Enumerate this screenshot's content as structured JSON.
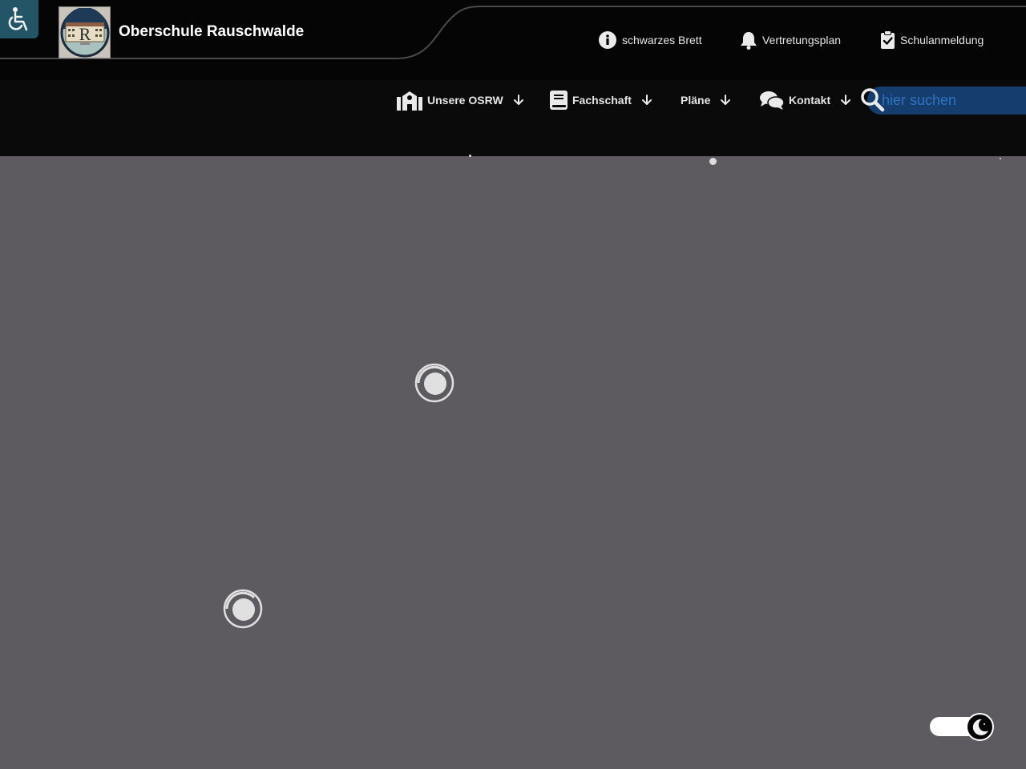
{
  "site": {
    "title": "Oberschule Rauschwalde",
    "logo_letter": "R"
  },
  "top_links": [
    {
      "label": "schwarzes Brett",
      "icon": "info-circle-icon"
    },
    {
      "label": "Vertretungsplan",
      "icon": "bell-icon"
    },
    {
      "label": "Schulanmeldung",
      "icon": "clipboard-check-icon"
    }
  ],
  "nav": [
    {
      "label": "Unsere OSRW",
      "icon": "school-icon"
    },
    {
      "label": "Fachschaft",
      "icon": "book-icon"
    },
    {
      "label": "Pläne",
      "icon": ""
    },
    {
      "label": "Kontakt",
      "icon": "chat-bubbles-icon"
    }
  ],
  "search": {
    "placeholder": "hier suchen"
  },
  "icons": {
    "accessibility": "wheelchair-icon",
    "theme_toggle": "moon-icon",
    "loading": "spinner-icon"
  },
  "colors": {
    "topbar_bg": "#050505",
    "navbar_bg": "#0a0a0a",
    "content_bg": "#5d5b60",
    "accessibility_bg": "#235566",
    "search_bg": "#153e6e",
    "search_text": "#2f73c2"
  }
}
